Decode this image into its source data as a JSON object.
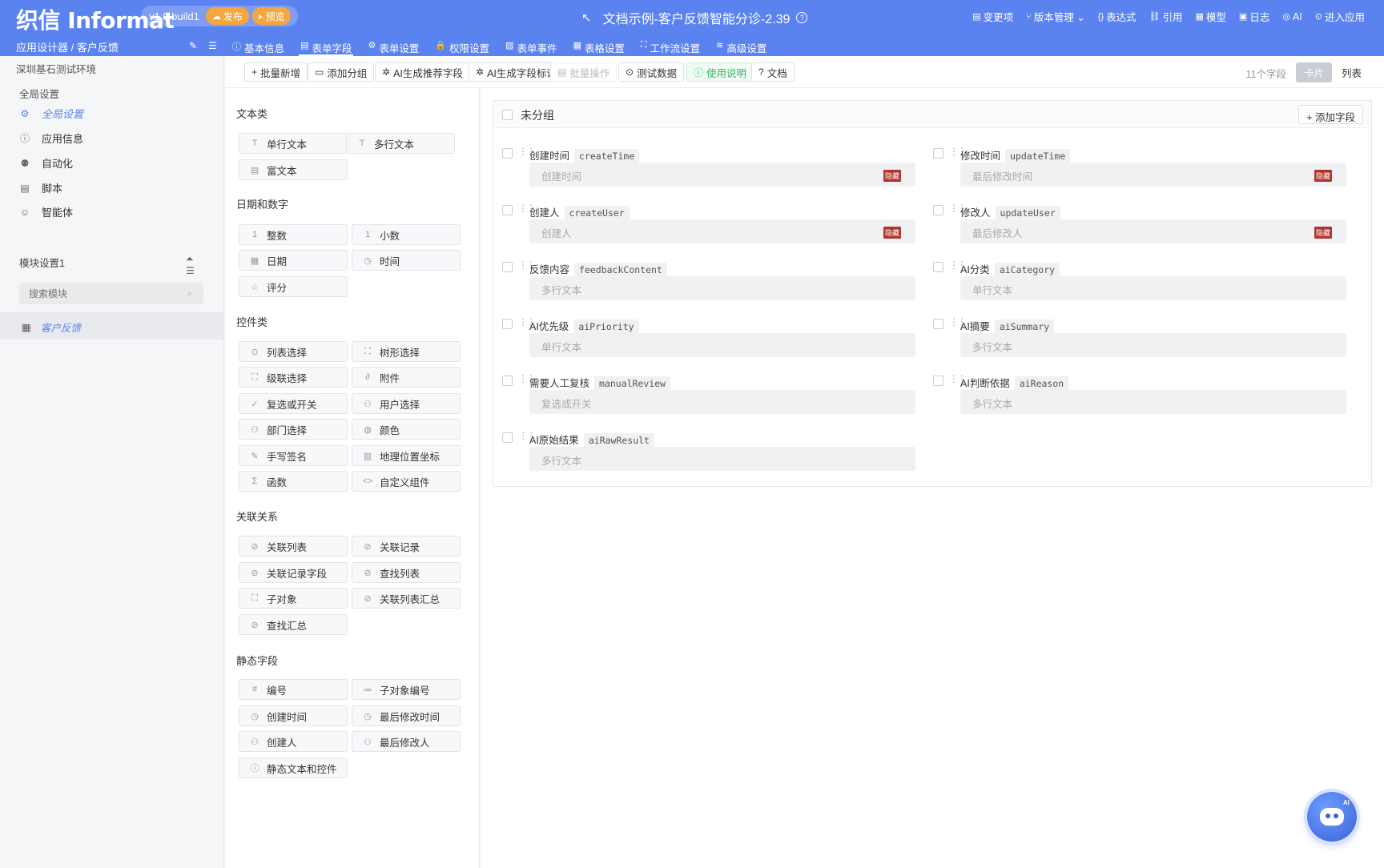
{
  "header": {
    "logo": "织信 Informat",
    "version": "v1.0 build1",
    "publish": "发布",
    "preview": "预览",
    "title": "文档示例-客户反馈智能分诊-2.39",
    "right_items": [
      {
        "icon": "changes-icon",
        "glyph": "▤",
        "label": "变更项"
      },
      {
        "icon": "branch-icon",
        "glyph": "⑂",
        "label": "版本管理 ⌄"
      },
      {
        "icon": "braces-icon",
        "glyph": "{}",
        "label": "表达式"
      },
      {
        "icon": "link-icon",
        "glyph": "⛓",
        "label": "引用"
      },
      {
        "icon": "model-icon",
        "glyph": "▦",
        "label": "模型"
      },
      {
        "icon": "log-icon",
        "glyph": "▣",
        "label": "日志"
      },
      {
        "icon": "ai-icon",
        "glyph": "◎",
        "label": "AI"
      },
      {
        "icon": "enter-icon",
        "glyph": "⊙",
        "label": "进入应用"
      }
    ],
    "breadcrumb": "应用设计器 / 客户反馈",
    "tabs": [
      {
        "icon": "info-icon",
        "glyph": "ⓘ",
        "label": "基本信息"
      },
      {
        "icon": "form-icon",
        "glyph": "▤",
        "label": "表单字段",
        "active": true
      },
      {
        "icon": "settings-icon",
        "glyph": "⚙",
        "label": "表单设置"
      },
      {
        "icon": "lock-icon",
        "glyph": "🔒",
        "label": "权限设置"
      },
      {
        "icon": "event-icon",
        "glyph": "▧",
        "label": "表单事件"
      },
      {
        "icon": "table-icon",
        "glyph": "▦",
        "label": "表格设置"
      },
      {
        "icon": "workflow-icon",
        "glyph": "⛶",
        "label": "工作流设置"
      },
      {
        "icon": "advanced-icon",
        "glyph": "≋",
        "label": "高级设置"
      }
    ]
  },
  "sidebar": {
    "env": "深圳基石测试环境",
    "global_title": "全局设置",
    "items": [
      {
        "icon": "gear-icon",
        "glyph": "⚙",
        "label": "全局设置",
        "active": true
      },
      {
        "icon": "info-icon",
        "glyph": "ⓘ",
        "label": "应用信息"
      },
      {
        "icon": "robot-icon",
        "glyph": "⚉",
        "label": "自动化"
      },
      {
        "icon": "script-icon",
        "glyph": "▤",
        "label": "脚本"
      },
      {
        "icon": "agent-icon",
        "glyph": "☺",
        "label": "智能体"
      }
    ],
    "module_title": "模块设置1",
    "search_placeholder": "搜索模块",
    "module_item": "客户反馈"
  },
  "toolbar": {
    "buttons": [
      {
        "icon": "plus-icon",
        "glyph": "+",
        "label": "批量新增"
      },
      {
        "icon": "folder-icon",
        "glyph": "▭",
        "label": "添加分组"
      },
      {
        "icon": "ai-gen-icon",
        "glyph": "✲",
        "label": "AI生成推荐字段"
      },
      {
        "icon": "ai-id-icon",
        "glyph": "✲",
        "label": "AI生成字段标识符"
      },
      {
        "icon": "batch-icon",
        "glyph": "▤",
        "label": "批量操作"
      },
      {
        "icon": "test-icon",
        "glyph": "⊙",
        "label": "测试数据"
      },
      {
        "icon": "help-icon",
        "glyph": "ⓘ",
        "label": "使用说明"
      },
      {
        "icon": "doc-icon",
        "glyph": "?",
        "label": "文档"
      }
    ],
    "field_count": "11个字段",
    "view_card": "卡片",
    "view_list": "列表"
  },
  "palette": {
    "categories": [
      "文本类",
      "日期和数字",
      "控件类",
      "关联关系",
      "静态字段"
    ],
    "text": [
      {
        "icon": "text-icon",
        "glyph": "T",
        "label": "单行文本"
      },
      {
        "icon": "multiline-text-icon",
        "glyph": "T",
        "label": "多行文本"
      },
      {
        "icon": "richtext-icon",
        "glyph": "▤",
        "label": "富文本"
      }
    ],
    "date_number": [
      {
        "icon": "integer-icon",
        "glyph": "1",
        "label": "整数"
      },
      {
        "icon": "decimal-icon",
        "glyph": "1",
        "label": "小数"
      },
      {
        "icon": "calendar-icon",
        "glyph": "▦",
        "label": "日期"
      },
      {
        "icon": "clock-icon",
        "glyph": "◷",
        "label": "时间"
      },
      {
        "icon": "star-icon",
        "glyph": "☆",
        "label": "评分"
      }
    ],
    "controls": [
      {
        "icon": "list-select-icon",
        "glyph": "⊙",
        "label": "列表选择"
      },
      {
        "icon": "tree-select-icon",
        "glyph": "⛶",
        "label": "树形选择"
      },
      {
        "icon": "cascade-icon",
        "glyph": "⛶",
        "label": "级联选择"
      },
      {
        "icon": "attachment-icon",
        "glyph": "∂",
        "label": "附件"
      },
      {
        "icon": "check-icon",
        "glyph": "✓",
        "label": "复选或开关"
      },
      {
        "icon": "user-icon",
        "glyph": "⚇",
        "label": "用户选择"
      },
      {
        "icon": "dept-icon",
        "glyph": "⚇",
        "label": "部门选择"
      },
      {
        "icon": "palette-icon",
        "glyph": "◍",
        "label": "颜色"
      },
      {
        "icon": "pen-icon",
        "glyph": "✎",
        "label": "手写签名"
      },
      {
        "icon": "map-icon",
        "glyph": "▥",
        "label": "地理位置坐标"
      },
      {
        "icon": "sigma-icon",
        "glyph": "Σ",
        "label": "函数"
      },
      {
        "icon": "code-icon",
        "glyph": "<>",
        "label": "自定义组件"
      }
    ],
    "relations": [
      {
        "icon": "link-icon",
        "glyph": "⊘",
        "label": "关联列表"
      },
      {
        "icon": "link-icon",
        "glyph": "⊘",
        "label": "关联记录"
      },
      {
        "icon": "link-icon",
        "glyph": "⊘",
        "label": "关联记录字段"
      },
      {
        "icon": "link-icon",
        "glyph": "⊘",
        "label": "查找列表"
      },
      {
        "icon": "subobject-icon",
        "glyph": "⛶",
        "label": "子对象"
      },
      {
        "icon": "link-icon",
        "glyph": "⊘",
        "label": "关联列表汇总"
      },
      {
        "icon": "link-icon",
        "glyph": "⊘",
        "label": "查找汇总"
      }
    ],
    "static": [
      {
        "icon": "hash-icon",
        "glyph": "#",
        "label": "编号"
      },
      {
        "icon": "list-number-icon",
        "glyph": "≔",
        "label": "子对象编号"
      },
      {
        "icon": "clock-icon",
        "glyph": "◷",
        "label": "创建时间"
      },
      {
        "icon": "clock-icon",
        "glyph": "◷",
        "label": "最后修改时间"
      },
      {
        "icon": "user-icon",
        "glyph": "⚇",
        "label": "创建人"
      },
      {
        "icon": "user-icon",
        "glyph": "⚇",
        "label": "最后修改人"
      },
      {
        "icon": "info-icon",
        "glyph": "ⓘ",
        "label": "静态文本和控件"
      }
    ]
  },
  "group": {
    "title": "未分组",
    "add_field": "+ 添加字段",
    "fields": [
      {
        "name": "创建时间",
        "key": "createTime",
        "placeholder": "创建时间",
        "hidden": true
      },
      {
        "name": "修改时间",
        "key": "updateTime",
        "placeholder": "最后修改时间",
        "hidden": true
      },
      {
        "name": "创建人",
        "key": "createUser",
        "placeholder": "创建人",
        "hidden": true
      },
      {
        "name": "修改人",
        "key": "updateUser",
        "placeholder": "最后修改人",
        "hidden": true
      },
      {
        "name": "反馈内容",
        "key": "feedbackContent",
        "placeholder": "多行文本",
        "hidden": false
      },
      {
        "name": "AI分类",
        "key": "aiCategory",
        "placeholder": "单行文本",
        "hidden": false
      },
      {
        "name": "AI优先级",
        "key": "aiPriority",
        "placeholder": "单行文本",
        "hidden": false
      },
      {
        "name": "AI摘要",
        "key": "aiSummary",
        "placeholder": "多行文本",
        "hidden": false
      },
      {
        "name": "需要人工复核",
        "key": "manualReview",
        "placeholder": "复选或开关",
        "hidden": false
      },
      {
        "name": "AI判断依据",
        "key": "aiReason",
        "placeholder": "多行文本",
        "hidden": false
      },
      {
        "name": "AI原始结果",
        "key": "aiRawResult",
        "placeholder": "多行文本",
        "hidden": false
      }
    ],
    "hidden_badge": "隐藏"
  },
  "bot_badge": "AI",
  "colors": {
    "primary": "#5b83f0",
    "accent_orange": "#f4a63f",
    "hidden_red": "#b0362d",
    "green": "#3bb56a"
  }
}
